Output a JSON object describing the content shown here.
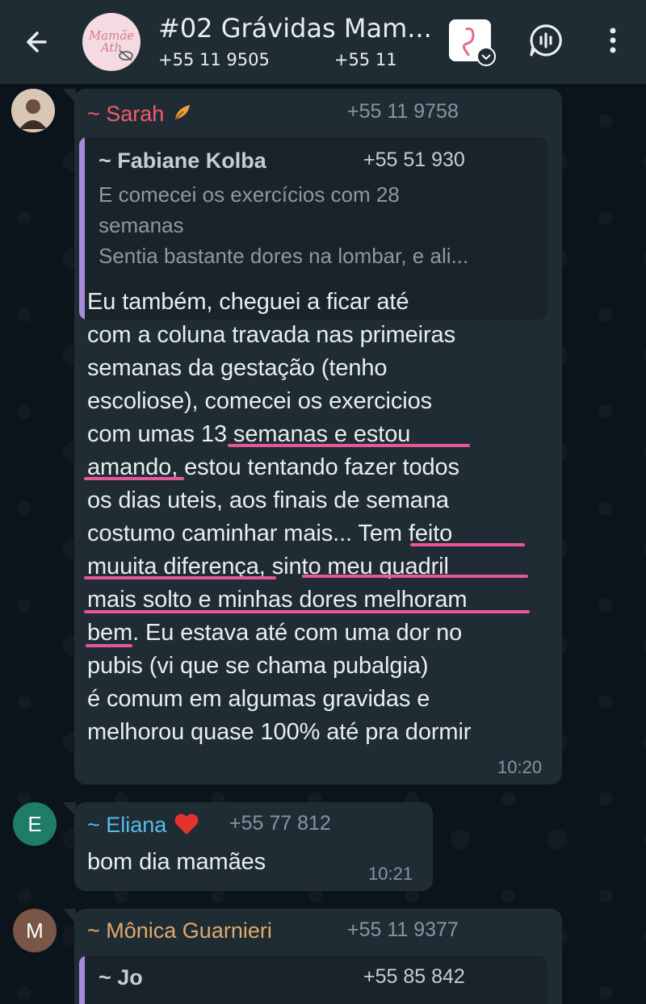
{
  "header": {
    "title": "#02 Grávidas Mam...",
    "subtitle_phones": [
      "+55 11 9505",
      "+55 11"
    ],
    "avatar_text": [
      "Mamãe",
      "Ath"
    ]
  },
  "messages": [
    {
      "sender": "~ Sarah",
      "sender_color": "#f15c6d",
      "phone": "+55 11 9758",
      "quote": {
        "name": "~ Fabiane Kolba",
        "phone": "+55 51 930",
        "lines": [
          "E comecei os exercícios com 28",
          "semanas",
          "Sentia bastante dores na lombar, e ali..."
        ]
      },
      "lines": [
        "Eu também, cheguei a ficar até",
        "com a coluna travada nas primeiras",
        "semanas da gestação (tenho",
        "escoliose), comecei os exercicios",
        "com umas 13 semanas e estou",
        "amando, estou tentando fazer todos",
        "os dias uteis, aos finais de semana",
        "costumo caminhar mais... Tem feito",
        "muuita diferença, sinto meu quadril",
        "mais solto e minhas dores melhoram",
        "bem. Eu estava até com uma dor no",
        "pubis (vi que se chama pubalgia)",
        "é comum em algumas gravidas e",
        "melhorou quase 100% até pra dormir"
      ],
      "time": "10:20"
    },
    {
      "sender": "~ Eliana",
      "sender_color": "#53bdeb",
      "avatar_letter": "E",
      "avatar_color": "#1e7c68",
      "phone": "+55 77 812",
      "lines": [
        "bom dia mamães"
      ],
      "time": "10:21"
    },
    {
      "sender": "~ Mônica Guarnieri",
      "sender_color": "#e0a96d",
      "avatar_letter": "M",
      "avatar_color": "#7a5646",
      "phone": "+55 11 9377",
      "quote": {
        "name": "~ Jo",
        "phone": "+55 85 842"
      }
    }
  ]
}
